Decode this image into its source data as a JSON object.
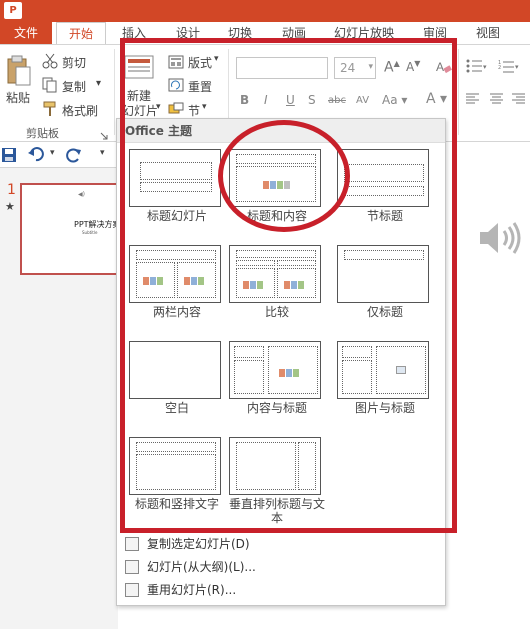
{
  "tabs": {
    "file": "文件",
    "home": "开始",
    "insert": "插入",
    "design": "设计",
    "transitions": "切换",
    "animations": "动画",
    "slideshow": "幻灯片放映",
    "review": "审阅",
    "view": "视图"
  },
  "clipboard": {
    "paste": "粘贴",
    "cut": "剪切",
    "copy": "复制",
    "copy_arrow": "▾",
    "format_painter": "格式刷",
    "group_label": "剪贴板"
  },
  "slides": {
    "new_slide_line1": "新建",
    "new_slide_line2": "幻灯片",
    "layout": "版式",
    "reset": "重置",
    "section": "节"
  },
  "font": {
    "size": "24"
  },
  "slide_panel": {
    "number": "1",
    "thumb_title": "PPT解决方案",
    "thumb_subtitle": "Subtitle"
  },
  "dropdown": {
    "header": "Office 主题",
    "layouts": [
      {
        "name": "标题幻灯片"
      },
      {
        "name": "标题和内容"
      },
      {
        "name": "节标题"
      },
      {
        "name": "两栏内容"
      },
      {
        "name": "比较"
      },
      {
        "name": "仅标题"
      },
      {
        "name": "空白"
      },
      {
        "name": "内容与标题"
      },
      {
        "name": "图片与标题"
      },
      {
        "name": "标题和竖排文字"
      },
      {
        "name": "垂直排列标题与文本"
      }
    ],
    "menu": [
      {
        "label": "复制选定幻灯片(D)"
      },
      {
        "label": "幻灯片(从大纲)(L)..."
      },
      {
        "label": "重用幻灯片(R)..."
      }
    ]
  },
  "colors": {
    "accent": "#d24726",
    "highlight": "#c8202a"
  }
}
